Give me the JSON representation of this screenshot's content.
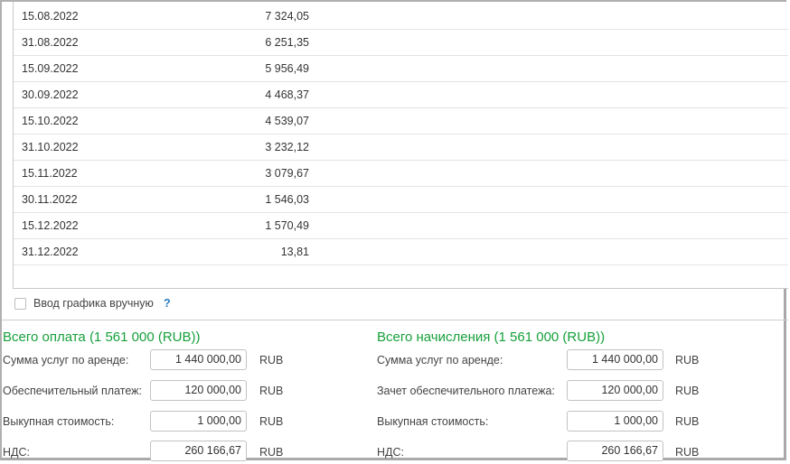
{
  "schedule": {
    "rows": [
      {
        "date": "15.08.2022",
        "amount": "7 324,05"
      },
      {
        "date": "31.08.2022",
        "amount": "6 251,35"
      },
      {
        "date": "15.09.2022",
        "amount": "5 956,49"
      },
      {
        "date": "30.09.2022",
        "amount": "4 468,37"
      },
      {
        "date": "15.10.2022",
        "amount": "4 539,07"
      },
      {
        "date": "31.10.2022",
        "amount": "3 232,12"
      },
      {
        "date": "15.11.2022",
        "amount": "3 079,67"
      },
      {
        "date": "30.11.2022",
        "amount": "1 546,03"
      },
      {
        "date": "15.12.2022",
        "amount": "1 570,49"
      },
      {
        "date": "31.12.2022",
        "amount": "13,81"
      }
    ]
  },
  "manual_schedule": {
    "label": "Ввод графика вручную",
    "help": "?",
    "checked": false
  },
  "payment": {
    "title": "Всего оплата (1 561 000 (RUB))",
    "fields": [
      {
        "label": "Сумма услуг по аренде:",
        "value": "1 440 000,00",
        "currency": "RUB"
      },
      {
        "label": "Обеспечительный платеж:",
        "value": "120 000,00",
        "currency": "RUB"
      },
      {
        "label": "Выкупная стоимость:",
        "value": "1 000,00",
        "currency": "RUB"
      },
      {
        "label": "НДС:",
        "value": "260 166,67",
        "currency": "RUB"
      }
    ]
  },
  "accrual": {
    "title": "Всего начисления (1 561 000 (RUB))",
    "fields": [
      {
        "label": "Сумма услуг по аренде:",
        "value": "1 440 000,00",
        "currency": "RUB"
      },
      {
        "label": "Зачет обеспечительного платежа:",
        "value": "120 000,00",
        "currency": "RUB"
      },
      {
        "label": "Выкупная стоимость:",
        "value": "1 000,00",
        "currency": "RUB"
      },
      {
        "label": "НДС:",
        "value": "260 166,67",
        "currency": "RUB"
      }
    ]
  },
  "colors": {
    "section_title": "#17a03b",
    "help": "#2a7bbd"
  }
}
